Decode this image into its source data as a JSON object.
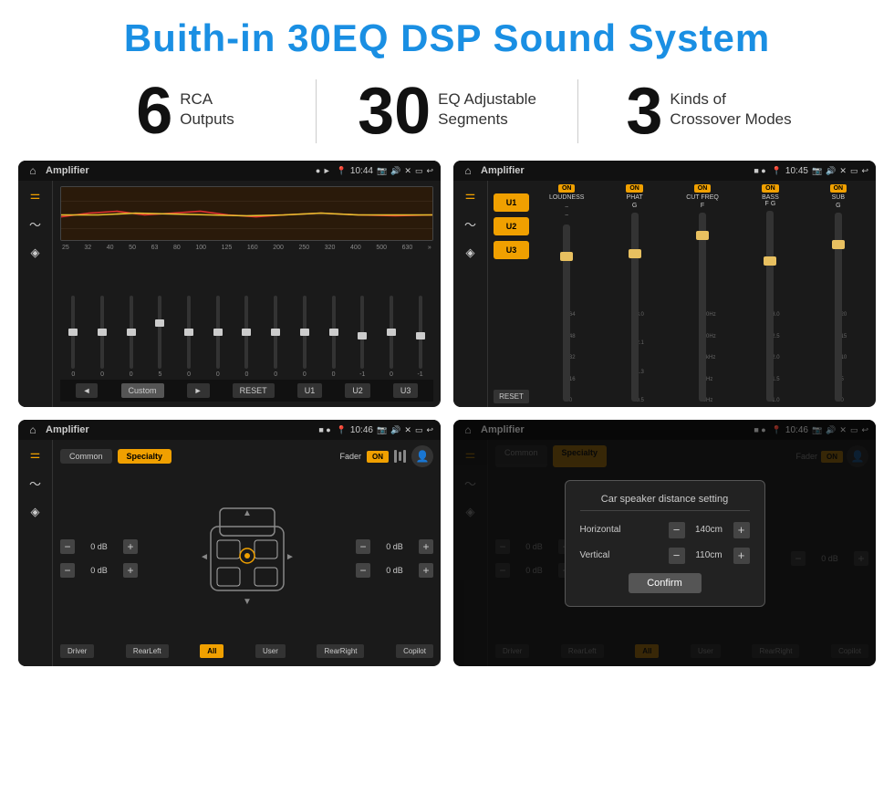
{
  "page": {
    "title": "Buith-in 30EQ DSP Sound System",
    "stats": [
      {
        "number": "6",
        "text": "RCA\nOutputs"
      },
      {
        "number": "30",
        "text": "EQ Adjustable\nSegments"
      },
      {
        "number": "3",
        "text": "Kinds of\nCrossover Modes"
      }
    ]
  },
  "screens": {
    "screen1": {
      "title": "Amplifier",
      "time": "10:44",
      "freq_labels": [
        "25",
        "32",
        "40",
        "50",
        "63",
        "80",
        "100",
        "125",
        "160",
        "200",
        "250",
        "320",
        "400",
        "500",
        "630"
      ],
      "slider_values": [
        "0",
        "0",
        "0",
        "5",
        "0",
        "0",
        "0",
        "0",
        "0",
        "0",
        "-1",
        "0",
        "-1"
      ],
      "bottom_btns": [
        "◄",
        "Custom",
        "►",
        "RESET",
        "U1",
        "U2",
        "U3"
      ]
    },
    "screen2": {
      "title": "Amplifier",
      "time": "10:45",
      "presets": [
        "U1",
        "U2",
        "U3"
      ],
      "channels": [
        {
          "label": "LOUDNESS",
          "on": true
        },
        {
          "label": "PHAT",
          "on": true
        },
        {
          "label": "CUT FREQ",
          "on": true
        },
        {
          "label": "BASS",
          "on": true
        },
        {
          "label": "SUB",
          "on": true
        }
      ],
      "reset_btn": "RESET"
    },
    "screen3": {
      "title": "Amplifier",
      "time": "10:46",
      "tabs": [
        "Common",
        "Specialty"
      ],
      "fader_label": "Fader",
      "fader_on": "ON",
      "levels": [
        "0 dB",
        "0 dB",
        "0 dB",
        "0 dB"
      ],
      "bottom_btns": [
        "Driver",
        "RearLeft",
        "All",
        "User",
        "RearRight",
        "Copilot"
      ]
    },
    "screen4": {
      "title": "Amplifier",
      "time": "10:46",
      "tabs": [
        "Common",
        "Specialty"
      ],
      "dialog": {
        "title": "Car speaker distance setting",
        "horizontal_label": "Horizontal",
        "horizontal_value": "140cm",
        "vertical_label": "Vertical",
        "vertical_value": "110cm",
        "confirm_btn": "Confirm"
      },
      "levels": [
        "0 dB",
        "0 dB"
      ],
      "bottom_btns": [
        "Driver",
        "RearLeft",
        "All",
        "User",
        "RearRight",
        "Copilot"
      ]
    }
  },
  "icons": {
    "home": "⌂",
    "play": "►",
    "pause": "⏸",
    "dot": "●",
    "location": "📍",
    "camera": "📷",
    "speaker": "🔊",
    "close": "✕",
    "minus_sign": "−",
    "plus_sign": "+",
    "back": "↩",
    "eq_icon": "⚌",
    "wave_icon": "〜",
    "volume_icon": "◈",
    "arrows": "»"
  }
}
